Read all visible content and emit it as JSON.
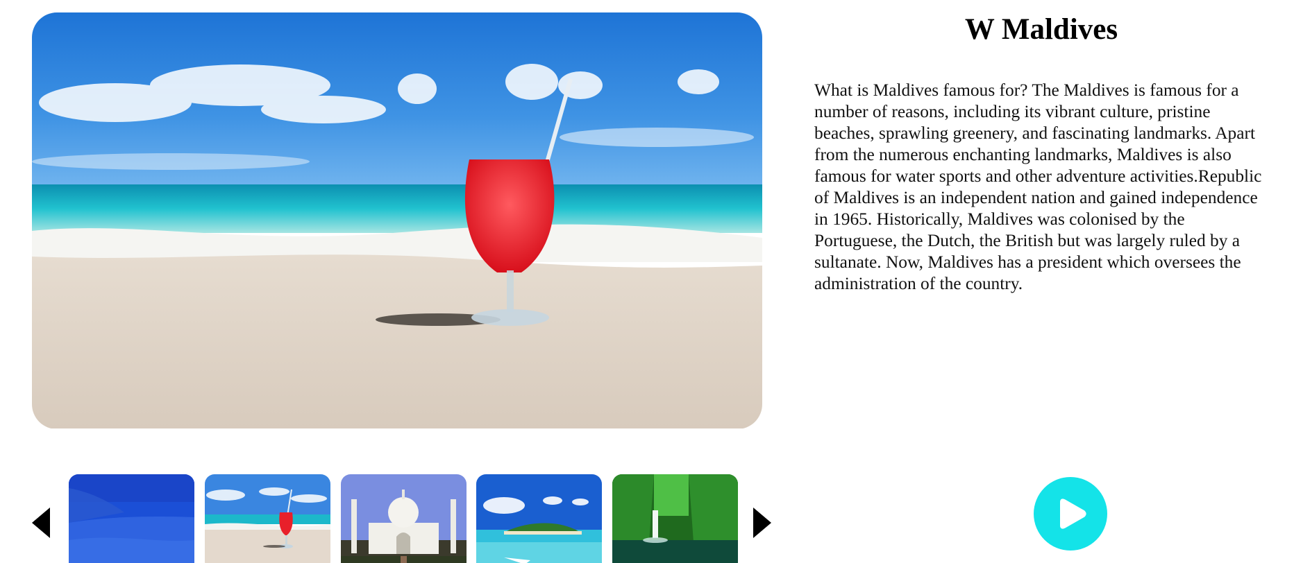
{
  "hero": {
    "image": "beach-drink-image"
  },
  "destination": {
    "title": "W Maldives",
    "description": "What is Maldives famous for? The Maldives is famous for a number of reasons, including its vibrant culture, pristine beaches, sprawling greenery, and fascinating landmarks. Apart from the numerous enchanting landmarks, Maldives is also famous for water sports and other adventure activities.Republic of Maldives is an independent nation and gained independence in 1965. Historically, Maldives was colonised by the Portuguese, the Dutch, the British but was largely ruled by a sultanate. Now, Maldives has a president which oversees the administration of the country."
  },
  "carousel": {
    "prev_icon": "chevron-left-icon",
    "next_icon": "chevron-right-icon",
    "thumbnails": [
      {
        "name": "blue-beach-thumbnail",
        "selected": true
      },
      {
        "name": "beach-drink-thumbnail",
        "selected": false
      },
      {
        "name": "taj-mahal-thumbnail",
        "selected": false
      },
      {
        "name": "tropical-island-thumbnail",
        "selected": false
      },
      {
        "name": "waterfall-thumbnail",
        "selected": false
      }
    ]
  },
  "play": {
    "icon": "play-icon"
  },
  "colors": {
    "play_button": "#14e3e8",
    "text": "#111111"
  }
}
